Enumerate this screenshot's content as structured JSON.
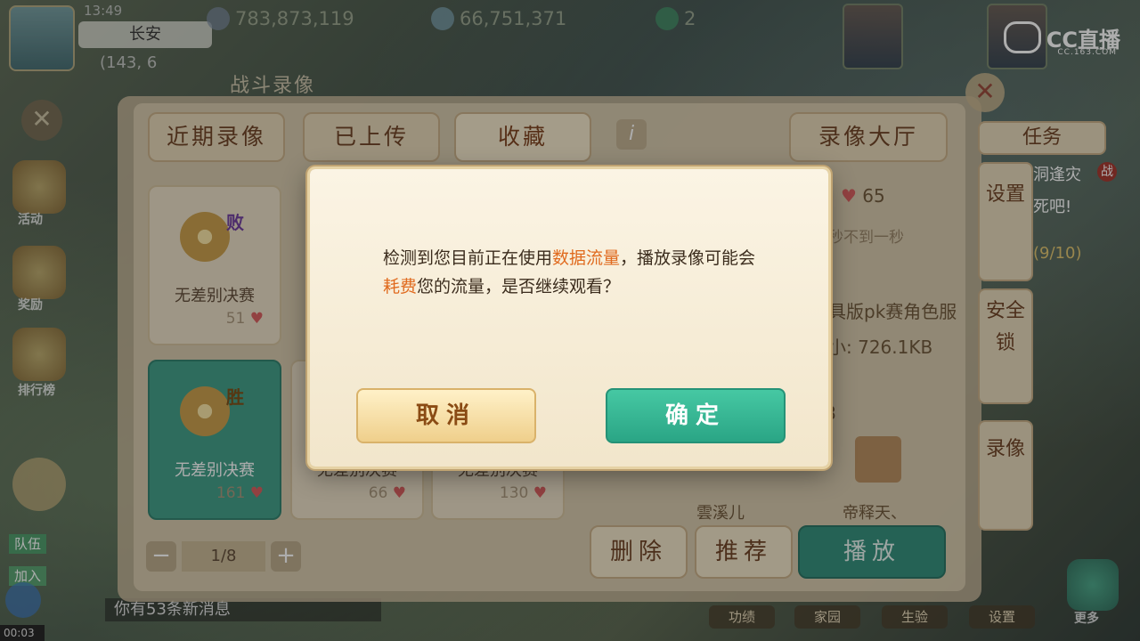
{
  "hud": {
    "time": "13:49",
    "location": "长安",
    "coords": "(143, 6",
    "currency_1": "783,873,119",
    "currency_2": "66,751,371",
    "currency_3": "2"
  },
  "stream_logo": {
    "brand": "CC直播",
    "sub": "CC.163.COM"
  },
  "left_menu": [
    "活动",
    "奖励",
    "排行榜"
  ],
  "chat": {
    "team": "队伍",
    "join": "加入",
    "new_messages": "你有53条新消息",
    "timer": "00:03"
  },
  "panel": {
    "title": "战斗录像",
    "tabs": [
      "近期录像",
      "已上传",
      "收藏"
    ],
    "info": "i",
    "hall_button": "录像大厅",
    "cards": [
      {
        "badge": "败",
        "name": "无差别决赛",
        "likes": "51"
      },
      {
        "badge": "胜",
        "name": "无差别决赛",
        "likes": "161"
      },
      {
        "name": "无差别决赛",
        "likes": "66"
      },
      {
        "name": "无差别决赛",
        "likes": "130"
      }
    ],
    "pager": {
      "value": "1/8",
      "minus": "−",
      "plus": "+"
    },
    "detail": {
      "likes": "65",
      "duration_note": "秒不到一秒",
      "title_fragment": "具版pk赛角色服",
      "size": "小: 726.1KB",
      "count": "8",
      "player_1": "雲溪儿",
      "player_2": "帝释天、"
    },
    "actions": {
      "delete": "删除",
      "recommend": "推荐",
      "play": "播放"
    }
  },
  "right_menu": {
    "task": "任务",
    "settings": "设置",
    "lock": "安全锁",
    "record": "录像",
    "more": "更多",
    "quest_text": "洞逢灾",
    "quest_text2": "死吧!",
    "progress": "(9/10)",
    "tag": "战"
  },
  "bottom_menu": [
    "功绩",
    "家园",
    "生验",
    "设置"
  ],
  "dialog": {
    "text_before": "检测到您目前正在使用",
    "highlight_1": "数据流量",
    "text_middle": "，播放录像可能会",
    "highlight_2": "耗费",
    "text_after": "您的流量，是否继续观看？",
    "cancel": "取消",
    "confirm": "确定"
  },
  "colors": {
    "highlight": "#e06a1e",
    "confirm": "#2aa585",
    "cancel": "#efcf8b"
  }
}
